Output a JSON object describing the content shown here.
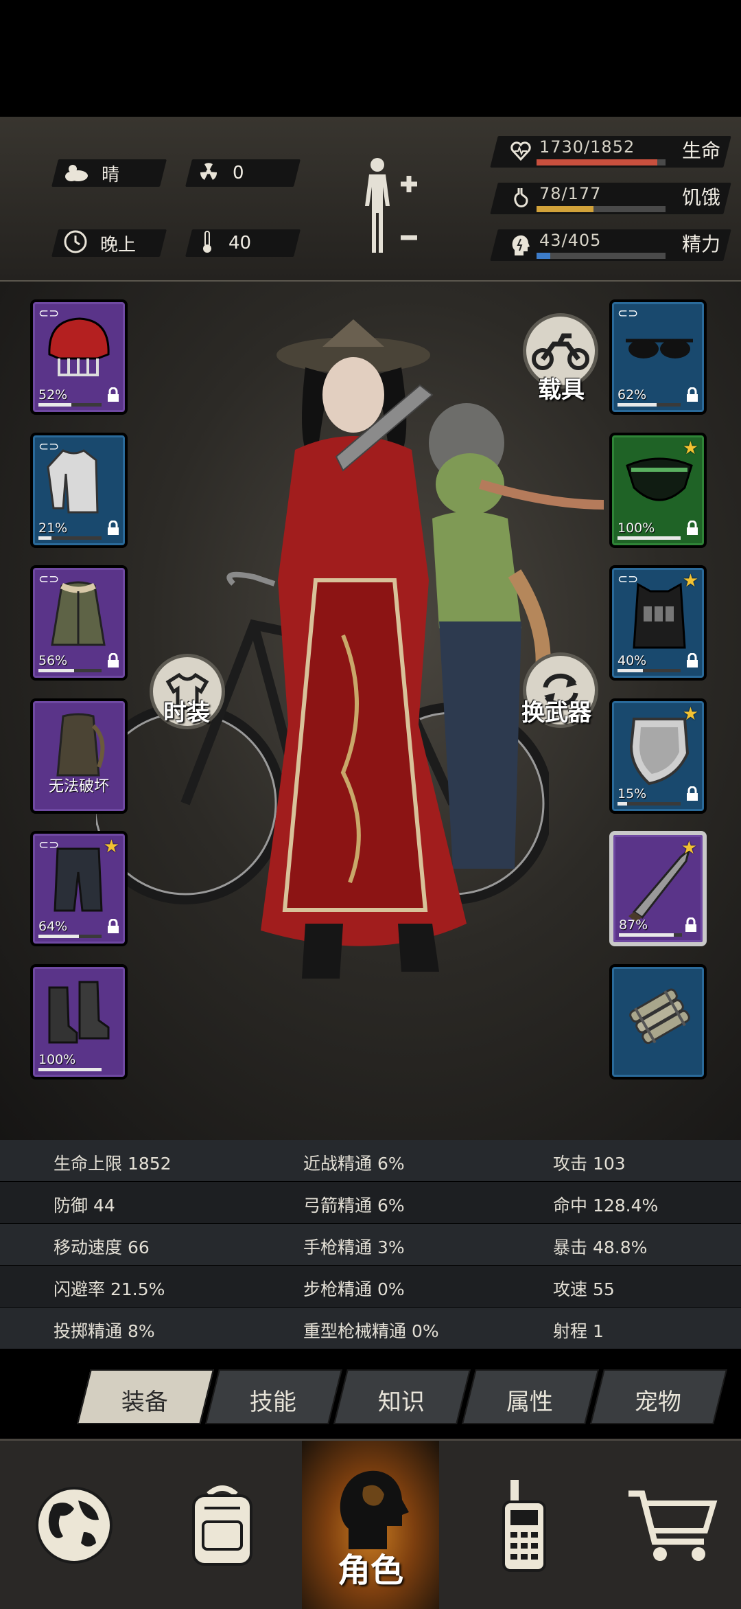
{
  "status": {
    "weather": "晴",
    "radiation": "0",
    "time_of_day": "晚上",
    "temperature": "40",
    "health": {
      "text": "1730/1852",
      "label": "生命",
      "fraction": 0.934,
      "color": "#c9503e"
    },
    "hunger": {
      "text": "78/177",
      "label": "饥饿",
      "fraction": 0.44,
      "color": "#d2a23a"
    },
    "energy": {
      "text": "43/405",
      "label": "精力",
      "fraction": 0.106,
      "color": "#3d7cc9"
    }
  },
  "left_slots": [
    {
      "name": "helmet-slot",
      "rarity": "purple",
      "percent": "52%",
      "durability": 0.52,
      "linked": true,
      "locked": true,
      "starred": false
    },
    {
      "name": "shirt-slot",
      "rarity": "blue",
      "percent": "21%",
      "durability": 0.21,
      "linked": true,
      "locked": true,
      "starred": false
    },
    {
      "name": "jacket-slot",
      "rarity": "purple",
      "percent": "56%",
      "durability": 0.56,
      "linked": true,
      "locked": true,
      "starred": false
    },
    {
      "name": "backpack-slot",
      "rarity": "purple",
      "label": "无法破坏",
      "linked": false,
      "locked": false,
      "starred": false
    },
    {
      "name": "pants-slot",
      "rarity": "purple",
      "percent": "64%",
      "durability": 0.64,
      "linked": true,
      "locked": true,
      "starred": true
    },
    {
      "name": "boots-slot",
      "rarity": "purple",
      "percent": "100%",
      "durability": 1.0,
      "linked": false,
      "locked": false,
      "starred": false
    }
  ],
  "right_slots": [
    {
      "name": "glasses-slot",
      "rarity": "blue",
      "percent": "62%",
      "durability": 0.62,
      "linked": true,
      "locked": true,
      "starred": false
    },
    {
      "name": "mask-slot",
      "rarity": "green",
      "percent": "100%",
      "durability": 1.0,
      "linked": false,
      "locked": true,
      "starred": true
    },
    {
      "name": "vest-slot",
      "rarity": "blue",
      "percent": "40%",
      "durability": 0.4,
      "linked": true,
      "locked": true,
      "starred": true
    },
    {
      "name": "shield-slot",
      "rarity": "blue",
      "percent": "15%",
      "durability": 0.15,
      "linked": false,
      "locked": true,
      "starred": true
    },
    {
      "name": "machete-slot",
      "rarity": "purple",
      "percent": "87%",
      "durability": 0.87,
      "linked": false,
      "locked": true,
      "starred": true,
      "selected": true
    },
    {
      "name": "explosive-slot",
      "rarity": "blue",
      "linked": false,
      "locked": false,
      "starred": false
    }
  ],
  "buttons": {
    "vehicle": "载具",
    "fashion": "时装",
    "swap_weapon": "换武器"
  },
  "attributes": [
    [
      "生命上限 1852",
      "近战精通 6%",
      "攻击 103"
    ],
    [
      "防御 44",
      "弓箭精通 6%",
      "命中 128.4%"
    ],
    [
      "移动速度 66",
      "手枪精通 3%",
      "暴击 48.8%"
    ],
    [
      "闪避率 21.5%",
      "步枪精通 0%",
      "攻速 55"
    ],
    [
      "投掷精通 8%",
      "重型枪械精通 0%",
      "射程 1"
    ]
  ],
  "tabs": [
    "装备",
    "技能",
    "知识",
    "属性",
    "宠物"
  ],
  "active_tab": 0,
  "nav": {
    "items": [
      "map-icon",
      "backpack-icon",
      "character-icon",
      "radio-icon",
      "cart-icon"
    ],
    "active_label": "角色"
  },
  "colors": {
    "purple_slot": "#5a3489",
    "blue_slot": "#19496e",
    "green_slot": "#1f6326",
    "star": "#f2c232",
    "nav_active": "#c77a20"
  }
}
